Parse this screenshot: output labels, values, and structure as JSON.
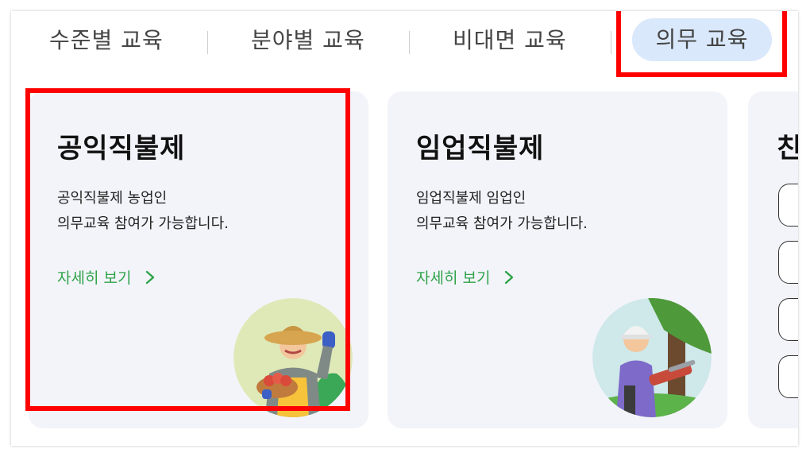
{
  "tabs": [
    {
      "label": "수준별 교육"
    },
    {
      "label": "분야별 교육"
    },
    {
      "label": "비대면 교육"
    },
    {
      "label": "의무 교육",
      "active": true
    }
  ],
  "cards": [
    {
      "title": "공익직불제",
      "desc_line1": "공익직불제 농업인",
      "desc_line2": "의무교육 참여가 가능합니다.",
      "link": "자세히 보기",
      "illustration": "farmer-illustration"
    },
    {
      "title": "임업직불제",
      "desc_line1": "임업직불제 임업인",
      "desc_line2": "의무교육 참여가 가능합니다.",
      "link": "자세히 보기",
      "illustration": "forester-illustration"
    },
    {
      "title": "친",
      "partial": true
    }
  ],
  "colors": {
    "active_tab_bg": "#d9e8fb",
    "card_bg": "#f3f4fa",
    "link_green": "#2fa34a",
    "highlight_red": "#ff0000"
  }
}
